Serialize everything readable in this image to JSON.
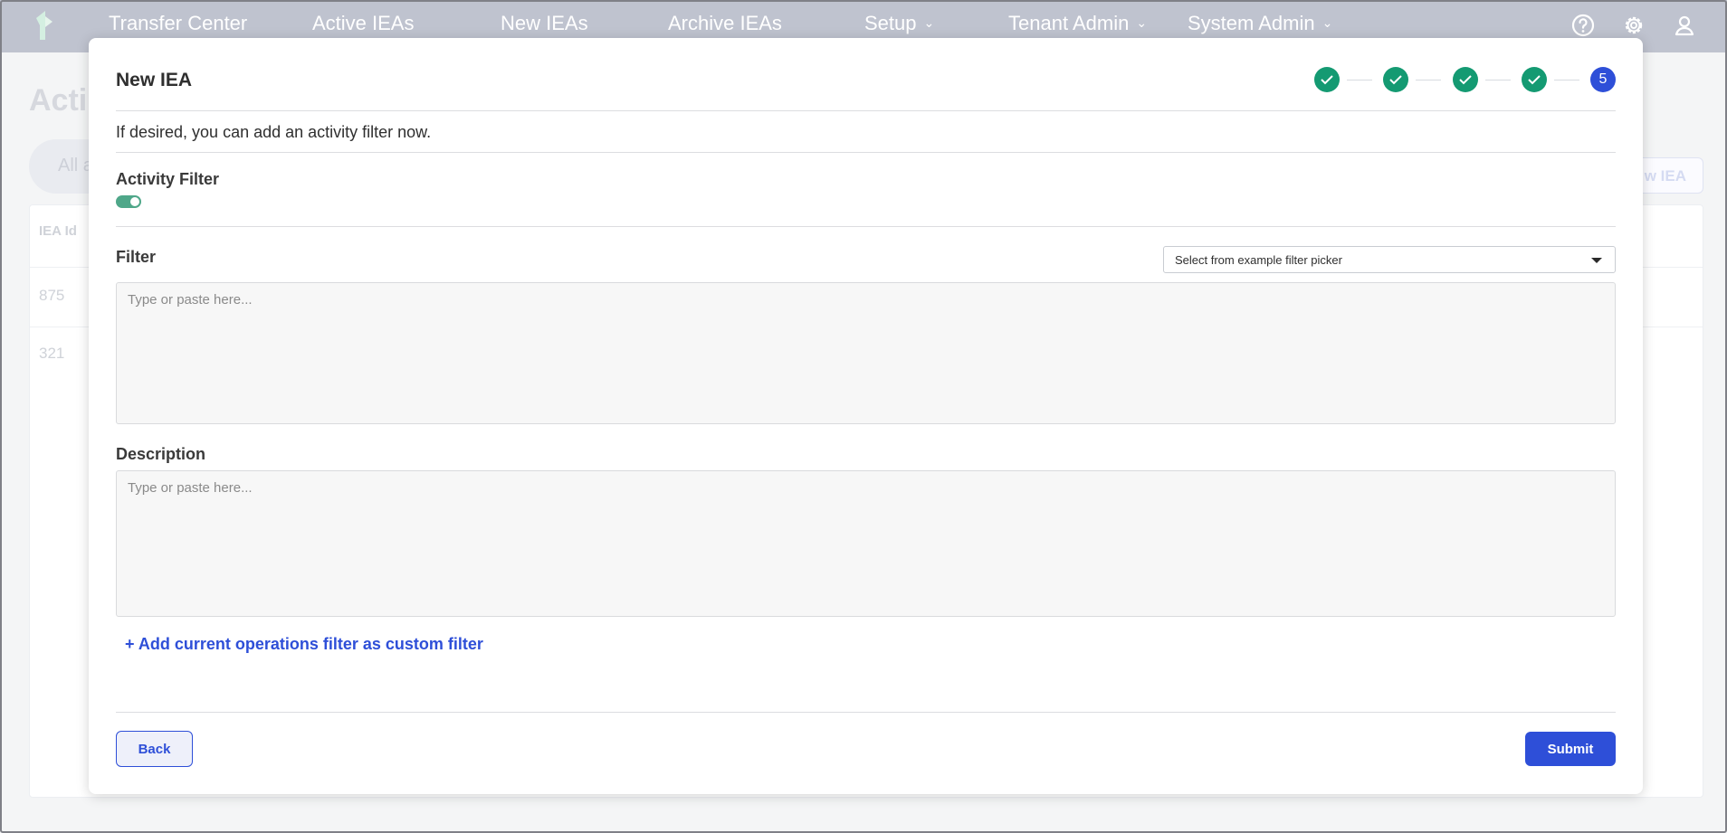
{
  "nav": {
    "items": [
      {
        "label": "Transfer Center"
      },
      {
        "label": "Active IEAs"
      },
      {
        "label": "New IEAs"
      },
      {
        "label": "Archive IEAs"
      },
      {
        "label": "Setup"
      },
      {
        "label": "Tenant Admin"
      },
      {
        "label": "System Admin"
      }
    ],
    "icons": [
      "help-icon",
      "gear-icon",
      "user-icon"
    ]
  },
  "background": {
    "page_title": "Acti",
    "search_placeholder": "All a",
    "new_button_label": "w IEA",
    "table_header_id": "IEA Id",
    "rows": [
      "875",
      "321"
    ]
  },
  "modal": {
    "title": "New IEA",
    "steps": [
      {
        "state": "done"
      },
      {
        "state": "done"
      },
      {
        "state": "done"
      },
      {
        "state": "done"
      },
      {
        "state": "current",
        "number": "5"
      }
    ],
    "intro": "If desired, you can add an activity filter now.",
    "activity_filter_label": "Activity Filter",
    "activity_filter_enabled": true,
    "filter_label": "Filter",
    "filter_picker_value": "Select from example filter picker",
    "filter_placeholder": "Type or paste here...",
    "description_label": "Description",
    "description_placeholder": "Type or paste here...",
    "add_filter_link": "+ Add current operations filter as custom filter",
    "back_label": "Back",
    "submit_label": "Submit"
  },
  "colors": {
    "accent": "#2e4fd8",
    "step_done": "#149a72",
    "toggle_on": "#4fa789",
    "topbar": "#bfc3cf"
  }
}
